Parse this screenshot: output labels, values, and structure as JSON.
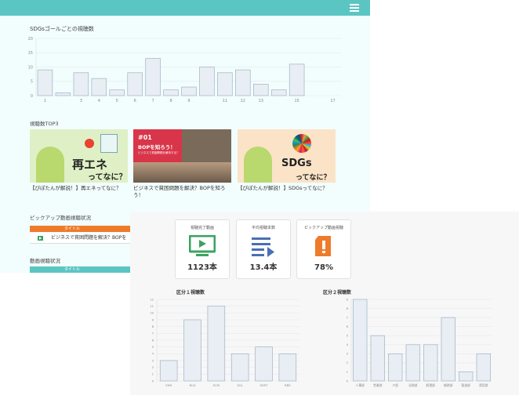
{
  "header": {
    "menu_icon": "hamburger-icon"
  },
  "sdg_section": {
    "title": "SDGsゴールごとの視聴数"
  },
  "top3": {
    "title": "視聴数TOP3",
    "items": [
      {
        "caption": "【ぴぽたんが解説！】再エネってなに？",
        "thumb_line1": "再エネ",
        "thumb_line2": "ってなに？",
        "badge": "ぴぽたんが解説"
      },
      {
        "caption": "ビジネスで貧困問題を解決？BOPを知ろう！",
        "thumb_line1": "#01",
        "thumb_line2": "BOPを知ろう！",
        "thumb_line3": "ビジネスで貧困問題を解決する？"
      },
      {
        "caption": "【ぴぽたんが解説！】SDGsってなに？",
        "thumb_line1": "SDGs",
        "thumb_line2": "ってなに？",
        "badge": "ぴぽたんが解説"
      }
    ]
  },
  "pickup": {
    "title": "ピックアップ動画視聴状況",
    "header_label": "タイトル",
    "row_title": "ビジネスで貧困問題を解決？BOPを"
  },
  "viewing": {
    "title": "動画視聴状況",
    "header_label": "タイトル"
  },
  "stats": [
    {
      "title": "視聴完了動画",
      "value": "1123本",
      "icon": "monitor-play-icon",
      "color": "#3aa35f"
    },
    {
      "title": "平均視聴本数",
      "value": "13.4本",
      "icon": "list-arrow-icon",
      "color": "#4a6fb3"
    },
    {
      "title": "ピックアップ動画視聴",
      "value": "78%",
      "icon": "exclamation-card-icon",
      "color": "#ee7b2c"
    }
  ],
  "colors": {
    "accent": "#5bc5c3",
    "bar_fill": "#e8eef3",
    "bar_stroke": "#9eb3c6",
    "orange": "#ee7b2c"
  },
  "chart_data": [
    {
      "type": "bar",
      "title": "SDGsゴールごとの視聴数",
      "categories": [
        "1",
        "2",
        "3",
        "4",
        "5",
        "6",
        "7",
        "8",
        "9",
        "10",
        "11",
        "12",
        "13",
        "14",
        "15",
        "16",
        "17"
      ],
      "x_ticks": [
        "1",
        "3",
        "4",
        "5",
        "6",
        "7",
        "8",
        "9",
        "11",
        "12",
        "13",
        "15",
        "17"
      ],
      "values": [
        9,
        1,
        8,
        6,
        2,
        8,
        13,
        2,
        3,
        10,
        8,
        9,
        4,
        2,
        11,
        0,
        0
      ],
      "ylim": [
        0,
        20
      ],
      "yticks": [
        "0",
        "5",
        "10",
        "15",
        "20"
      ]
    },
    {
      "type": "bar",
      "title": "区分１視聴数",
      "categories": [
        "SHR",
        "NLD",
        "SCM",
        "SGL",
        "SDST",
        "RBS"
      ],
      "values": [
        3,
        9,
        11,
        4,
        5,
        4
      ],
      "ylim": [
        0,
        12
      ],
      "yticks": [
        "0",
        "1",
        "2",
        "3",
        "4",
        "5",
        "6",
        "7",
        "8",
        "9",
        "10",
        "11",
        "12"
      ]
    },
    {
      "type": "bar",
      "title": "区分２視聴数",
      "categories": [
        "人事部",
        "営業部",
        "IT部",
        "法務部",
        "経理部",
        "総務部",
        "製造部",
        "運用部"
      ],
      "values": [
        9,
        5,
        3,
        4,
        4,
        7,
        1,
        3
      ],
      "ylim": [
        0,
        9
      ],
      "yticks": [
        "0",
        "1",
        "2",
        "3",
        "4",
        "5",
        "6",
        "7",
        "8",
        "9"
      ]
    }
  ]
}
